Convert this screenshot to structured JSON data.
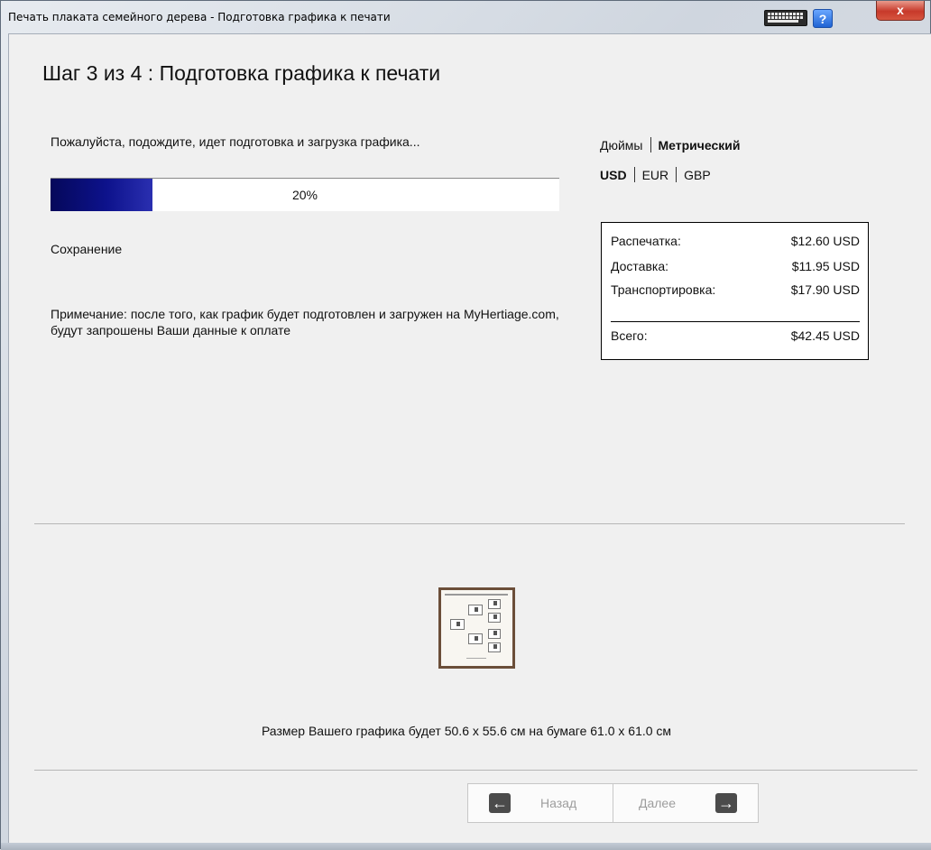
{
  "window": {
    "title": "Печать плаката семейного дерева - Подготовка графика к печати",
    "help_label": "?",
    "close_label": "x"
  },
  "step": {
    "title": "Шаг 3 из 4 : Подготовка графика к печати"
  },
  "progress": {
    "status_text": "Пожалуйста, подождите, идет подготовка и загрузка графика...",
    "percent": 20,
    "label": "20%",
    "stage": "Сохранение",
    "note": "Примечание: после того, как график будет подготовлен и загружен на MyHertiage.com, будут запрошены Ваши данные к оплате"
  },
  "units": {
    "options": [
      "Дюймы",
      "Метрический"
    ],
    "selected": "Метрический"
  },
  "currency": {
    "options": [
      "USD",
      "EUR",
      "GBP"
    ],
    "selected": "USD"
  },
  "pricing": {
    "rows": [
      {
        "label": "Распечатка:",
        "value": "$12.60 USD"
      },
      {
        "label": "Доставка:",
        "value": "$11.95 USD"
      },
      {
        "label": "Транспортировка:",
        "value": "$17.90 USD"
      }
    ],
    "total": {
      "label": "Всего:",
      "value": "$42.45 USD"
    }
  },
  "preview": {
    "size_text": "Размер Вашего графика будет 50.6 x 55.6 см на бумаге 61.0 x 61.0 см"
  },
  "navigation": {
    "back_label": "Назад",
    "next_label": "Далее",
    "back_icon": "arrow-left-icon",
    "next_icon": "arrow-right-icon"
  },
  "colors": {
    "progress_fill": "#0d128c",
    "client_bg": "#f0f0f0"
  }
}
